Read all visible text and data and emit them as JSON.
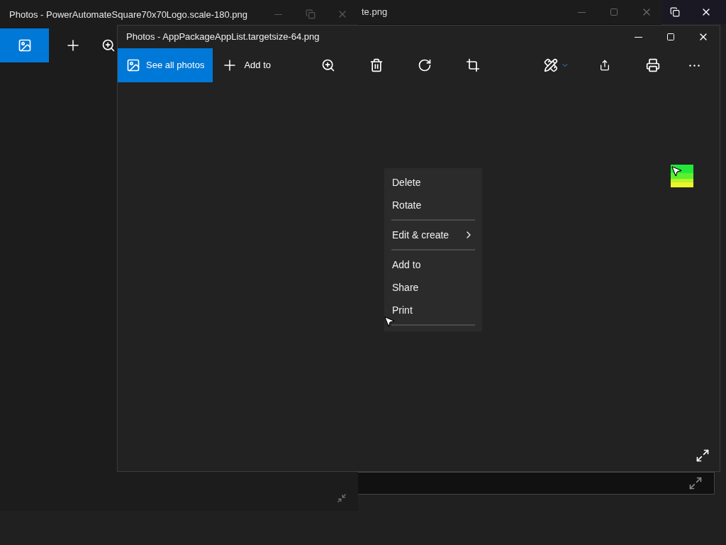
{
  "back_window": {
    "title": "te.png"
  },
  "left_window": {
    "title": "Photos - PowerAutomateSquare70x70Logo.scale-180.png"
  },
  "front_window": {
    "title": "Photos - AppPackageAppList.targetsize-64.png",
    "toolbar": [
      {
        "label": "See all photos",
        "kind": "accent"
      },
      {
        "label": "Add to",
        "kind": "plain"
      }
    ]
  },
  "context_menu": [
    {
      "kind": "item",
      "label": "Delete",
      "submenu": false
    },
    {
      "kind": "item",
      "label": "Rotate",
      "submenu": false
    },
    {
      "kind": "separator"
    },
    {
      "kind": "item",
      "label": "Edit & create",
      "submenu": true
    },
    {
      "kind": "separator"
    },
    {
      "kind": "item",
      "label": "Add to",
      "submenu": false
    },
    {
      "kind": "item",
      "label": "Share",
      "submenu": false
    },
    {
      "kind": "item",
      "label": "Print",
      "submenu": false
    },
    {
      "kind": "separator"
    }
  ]
}
